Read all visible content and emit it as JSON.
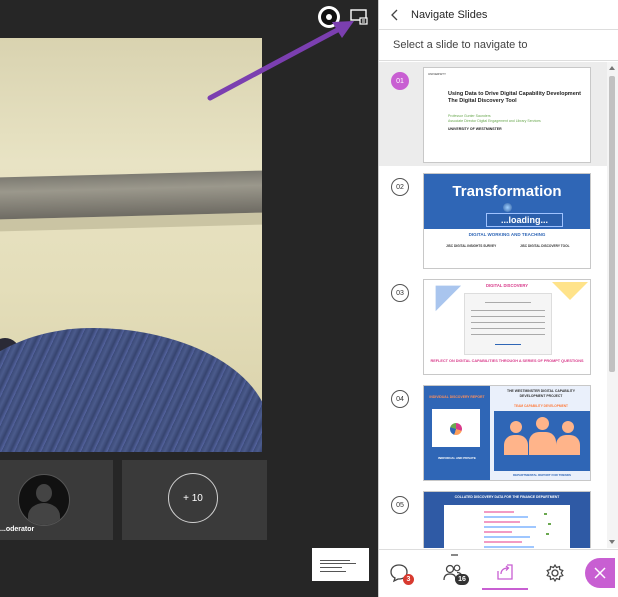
{
  "video": {
    "moderator_label": "...oderator",
    "more_participants": "+ 10"
  },
  "panel": {
    "title": "Navigate Slides",
    "subtitle": "Select a slide to navigate to"
  },
  "slides": [
    {
      "number": "01",
      "logo": "UNIVERSITY",
      "title": "Using Data to Drive Digital Capability Development The Digital Discovery Tool",
      "presenter_line1": "Professor Gunter Saunders",
      "presenter_line2": "Associate Director Digital Engagement and Library Services",
      "institution": "UNIVERSITY OF WESTMINSTER"
    },
    {
      "number": "02",
      "title": "Transformation",
      "loading": "...loading...",
      "subtitle": "DIGITAL WORKING AND TEACHING",
      "left_label": "JISC DIGITAL INSIGHTS SURVEY",
      "right_label": "JISC DIGITAL DISCOVERY TOOL"
    },
    {
      "number": "03",
      "title": "DIGITAL DISCOVERY",
      "footer": "REFLECT ON DIGITAL CAPABILITIES THROUGH A SERIES OF PROMPT QUESTIONS"
    },
    {
      "number": "04",
      "left_title": "INDIVIDUAL DISCOVERY REPORT",
      "left_footer": "INDIVIDUAL AND PRIVATE",
      "right_title": "THE WESTMINSTER DIGITAL CAPABILITY DEVELOPMENT PROJECT",
      "right_subtitle": "TEAM CAPABILITY DEVELOPMENT",
      "right_footer": "DEPARTMENTAL REPORT FOR TRENDS"
    },
    {
      "number": "05",
      "title": "COLLATED DISCOVERY DATA FOR THE FINANCE DEPARTMENT"
    }
  ],
  "toolbar": {
    "chat_badge": "3",
    "attendees_badge": "16"
  },
  "colors": {
    "accent": "#c85fd2",
    "arrow": "#7b3fb0",
    "slide_blue": "#2f66b6"
  }
}
